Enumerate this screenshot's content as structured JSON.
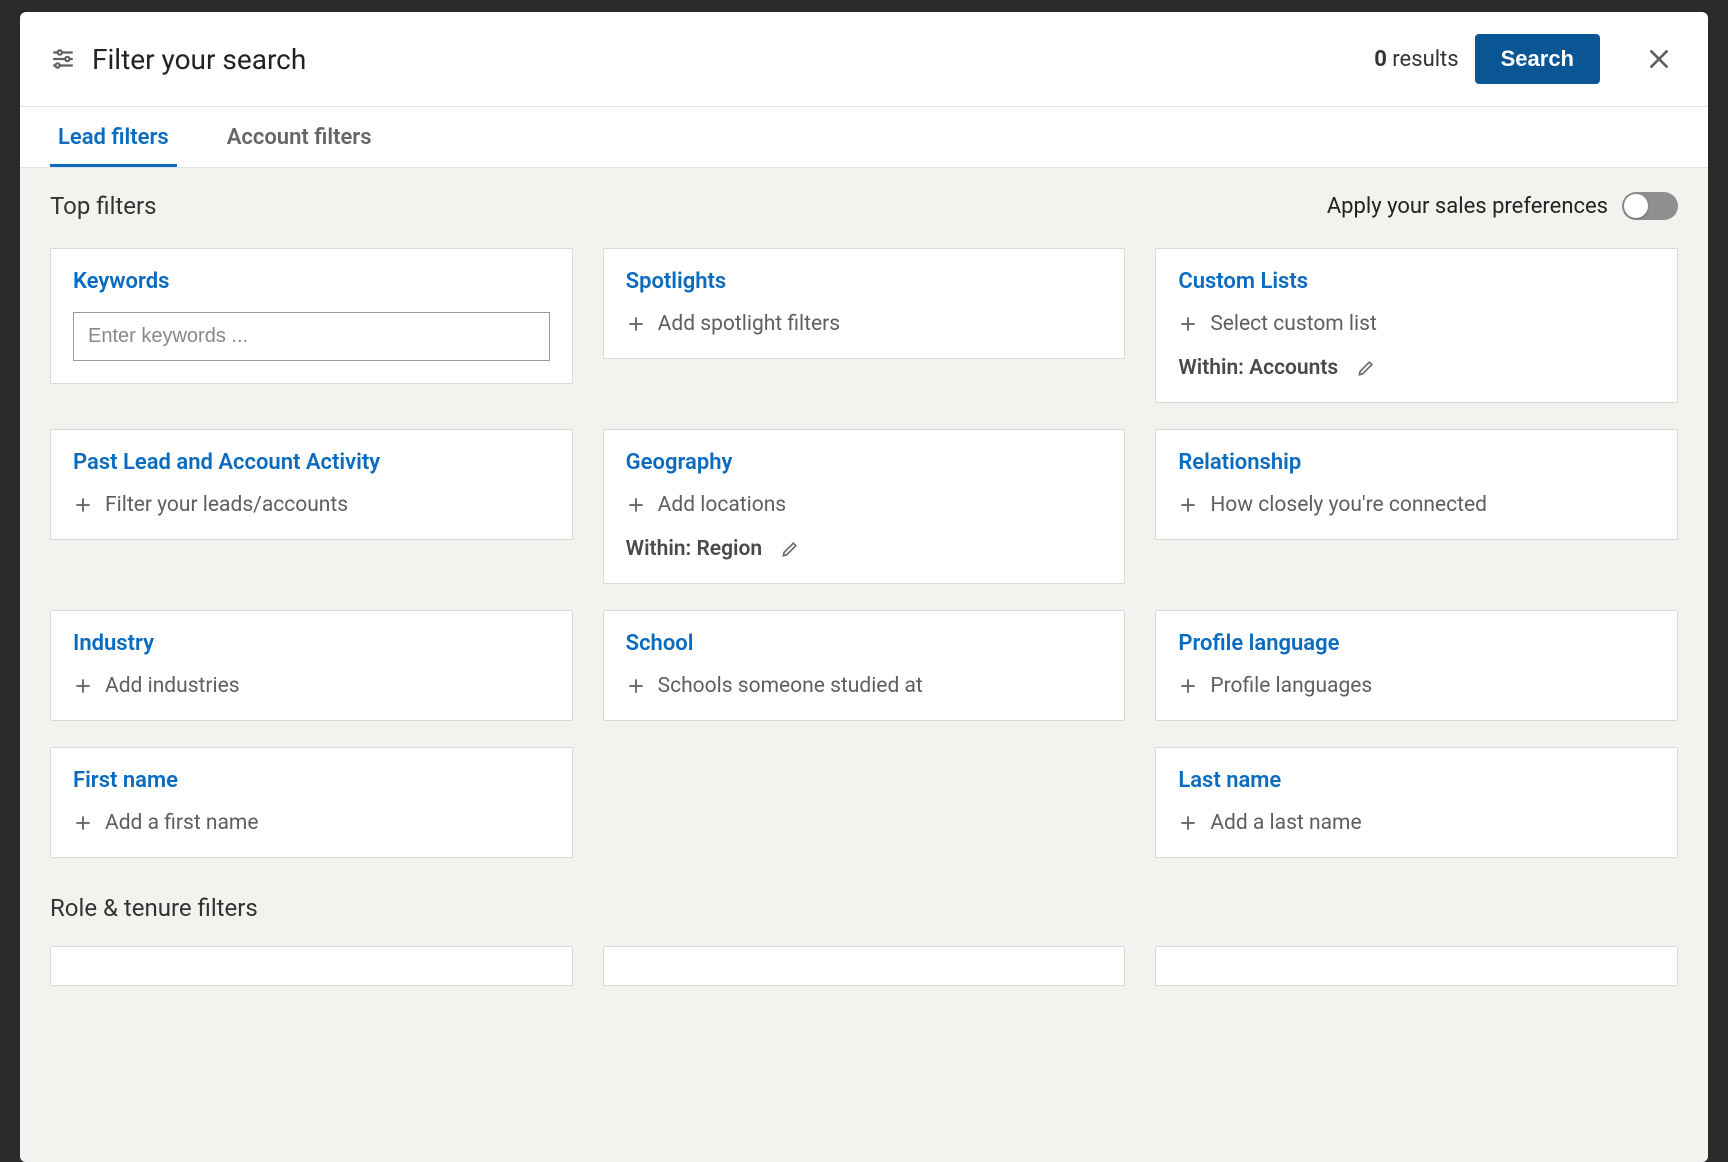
{
  "header": {
    "title": "Filter your search",
    "results_count": "0",
    "results_word": "results",
    "search_label": "Search"
  },
  "tabs": {
    "lead": "Lead filters",
    "account": "Account filters"
  },
  "sections": {
    "top_filters": "Top filters",
    "role_tenure": "Role & tenure filters",
    "prefs_label": "Apply your sales preferences"
  },
  "cards": {
    "keywords": {
      "title": "Keywords",
      "placeholder": "Enter keywords ..."
    },
    "spotlights": {
      "title": "Spotlights",
      "add": "Add spotlight filters"
    },
    "custom_lists": {
      "title": "Custom Lists",
      "add": "Select custom list",
      "within": "Within: Accounts"
    },
    "past_activity": {
      "title": "Past Lead and Account Activity",
      "add": "Filter your leads/accounts"
    },
    "geography": {
      "title": "Geography",
      "add": "Add locations",
      "within": "Within: Region"
    },
    "relationship": {
      "title": "Relationship",
      "add": "How closely you're connected"
    },
    "industry": {
      "title": "Industry",
      "add": "Add industries"
    },
    "school": {
      "title": "School",
      "add": "Schools someone studied at"
    },
    "profile_language": {
      "title": "Profile language",
      "add": "Profile languages"
    },
    "first_name": {
      "title": "First name",
      "add": "Add a first name"
    },
    "last_name": {
      "title": "Last name",
      "add": "Add a last name"
    }
  }
}
